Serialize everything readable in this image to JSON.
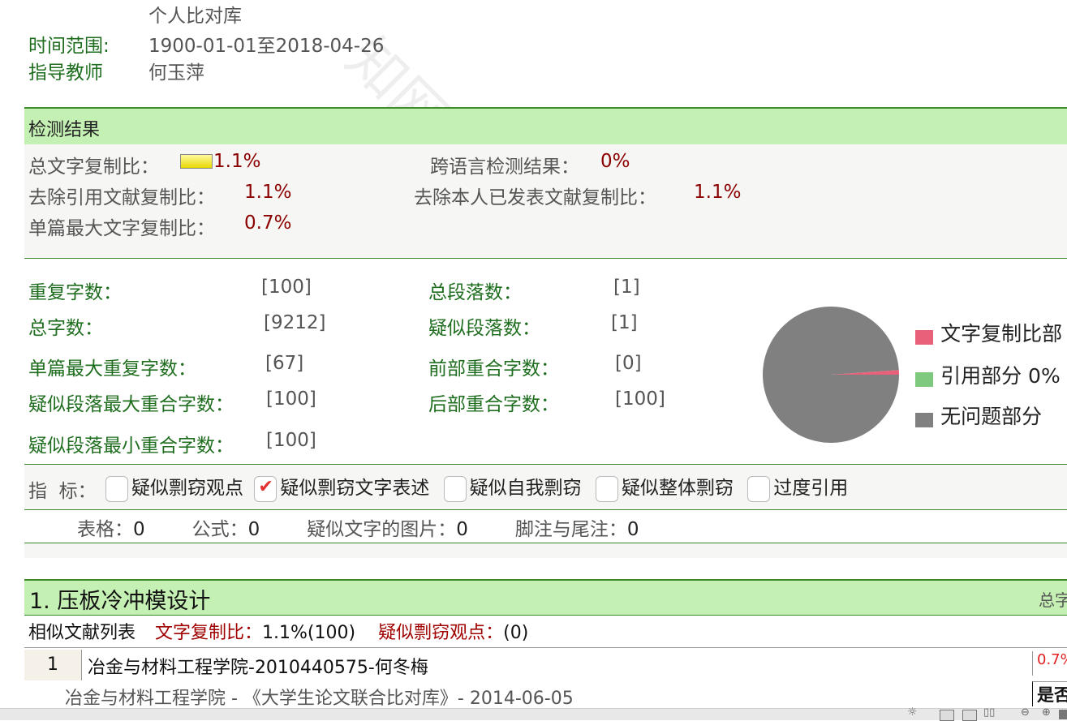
{
  "header": {
    "database_line": "个人比对库",
    "time_range_label": "时间范围:",
    "time_range_value": "1900-01-01至2018-04-26",
    "advisor_label": "指导教师",
    "advisor_value": "何玉萍"
  },
  "result": {
    "title": "检测结果",
    "total_copy_label": "总文字复制比：",
    "total_copy_value": "1.1%",
    "cross_lang_label": "跨语言检测结果：",
    "cross_lang_value": "0%",
    "exclude_ref_label": "去除引用文献复制比：",
    "exclude_ref_value": "1.1%",
    "exclude_self_label": "去除本人已发表文献复制比：",
    "exclude_self_value": "1.1%",
    "single_max_label": "单篇最大文字复制比：",
    "single_max_value": "0.7%",
    "copy_bar_fraction": 0.011
  },
  "stats": {
    "repeat_chars_label": "重复字数：",
    "repeat_chars_value": "[100]",
    "total_paras_label": "总段落数：",
    "total_paras_value": "[1]",
    "total_chars_label": "总字数：",
    "total_chars_value": "[9212]",
    "suspect_paras_label": "疑似段落数：",
    "suspect_paras_value": "[1]",
    "single_max_repeat_label": "单篇最大重复字数：",
    "single_max_repeat_value": "[67]",
    "front_overlap_label": "前部重合字数：",
    "front_overlap_value": "[0]",
    "para_max_overlap_label": "疑似段落最大重合字数：",
    "para_max_overlap_value": "[100]",
    "back_overlap_label": "后部重合字数：",
    "back_overlap_value": "[100]",
    "para_min_overlap_label": "疑似段落最小重合字数：",
    "para_min_overlap_value": "[100]"
  },
  "chart_data": {
    "type": "pie",
    "title": "",
    "series": [
      {
        "name": "文字复制比部分",
        "value": 1.1,
        "color": "#e8607a"
      },
      {
        "name": "引用部分",
        "value": 0,
        "color": "#7fc97f"
      },
      {
        "name": "无问题部分",
        "value": 98.9,
        "color": "#808080"
      }
    ],
    "legend_labels": [
      "文字复制比部",
      "引用部分 0%",
      "无问题部分"
    ]
  },
  "indicators": {
    "label": "指  标：",
    "items": [
      {
        "label": "疑似剽窃观点",
        "checked": false
      },
      {
        "label": "疑似剽窃文字表述",
        "checked": true
      },
      {
        "label": "疑似自我剽窃",
        "checked": false
      },
      {
        "label": "疑似整体剽窃",
        "checked": false
      },
      {
        "label": "过度引用",
        "checked": false
      }
    ]
  },
  "counts": {
    "table_label": "表格：",
    "table_value": "0",
    "formula_label": "公式：",
    "formula_value": "0",
    "image_label": "疑似文字的图片：",
    "image_value": "0",
    "footnote_label": "脚注与尾注：",
    "footnote_value": "0"
  },
  "section1": {
    "title": "1. 压板冷冲模设计",
    "right_label": "总字",
    "sim_list_label": "相似文献列表",
    "copy_ratio_label": "文字复制比：",
    "copy_ratio_value": "1.1%(100)",
    "suspect_view_label": "疑似剽窃观点：",
    "suspect_view_value": "(0)",
    "rows": [
      {
        "index": "1",
        "title": "冶金与材料工程学院-2010440575-何冬梅",
        "source": "冶金与材料工程学院 - 《大学生论文联合比对库》- 2014-06-05",
        "ratio": "0.7%",
        "flag": "是否"
      }
    ]
  },
  "watermark": "知网"
}
